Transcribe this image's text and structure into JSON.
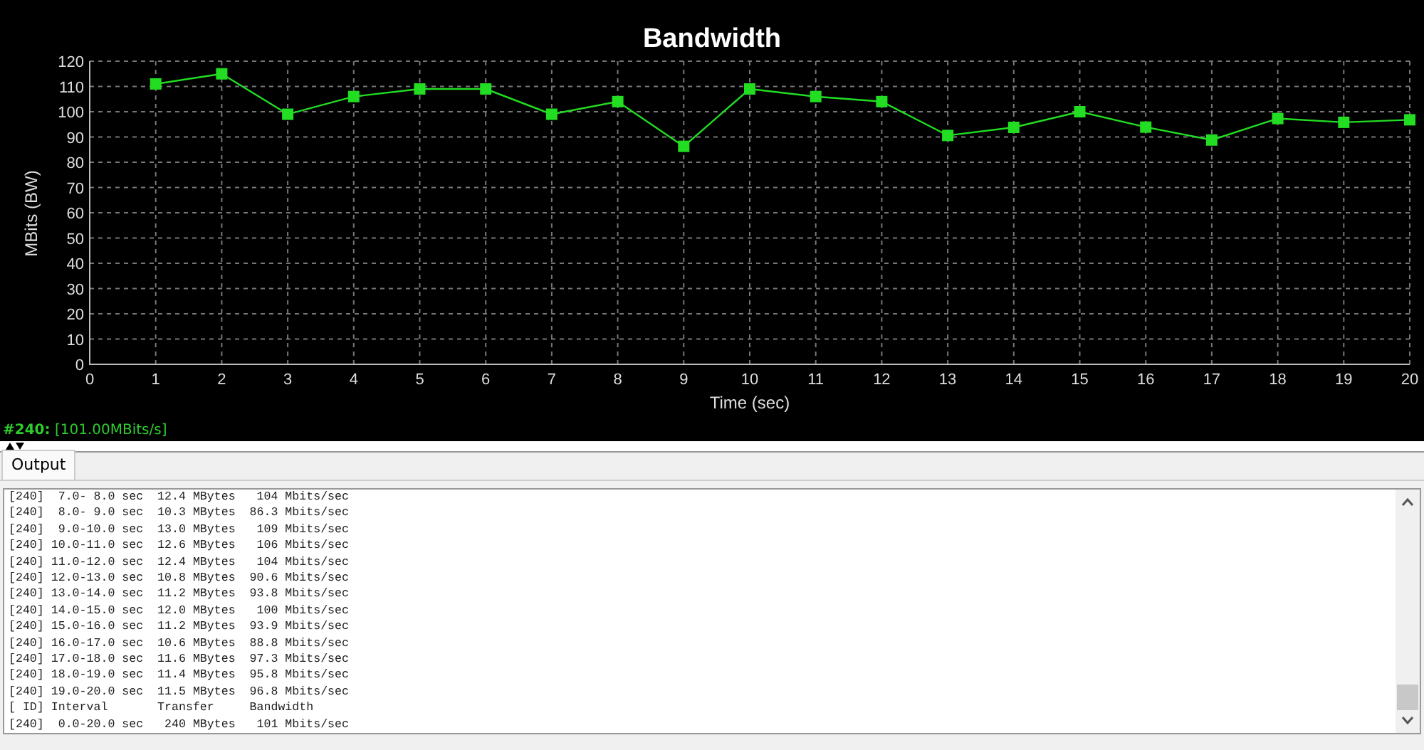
{
  "graph": {
    "chart_data": {
      "type": "line",
      "title": "Bandwidth",
      "xlabel": "Time (sec)",
      "ylabel": "MBits (BW)",
      "x": [
        1,
        2,
        3,
        4,
        5,
        6,
        7,
        8,
        9,
        10,
        11,
        12,
        13,
        14,
        15,
        16,
        17,
        18,
        19,
        20
      ],
      "grid": true,
      "series": [
        {
          "color": "#22dd22",
          "marker": "square",
          "values": [
            111,
            115,
            99,
            106,
            109,
            109,
            99,
            104,
            86.3,
            109,
            106,
            104,
            90.6,
            93.8,
            100,
            93.9,
            88.8,
            97.3,
            95.8,
            96.8
          ]
        }
      ],
      "xlim": [
        0,
        20
      ],
      "ylim": [
        0,
        120
      ],
      "xticks": [
        0,
        1,
        2,
        3,
        4,
        5,
        6,
        7,
        8,
        9,
        10,
        11,
        12,
        13,
        14,
        15,
        16,
        17,
        18,
        19,
        20
      ],
      "yticks": [
        0,
        10,
        20,
        30,
        40,
        50,
        60,
        70,
        80,
        90,
        100,
        110,
        120
      ]
    }
  },
  "status": {
    "stream": "#240:",
    "reading": "[101.00MBits/s]"
  },
  "tabs": [
    {
      "label": "Output",
      "selected": true
    }
  ],
  "output": {
    "lines": [
      "[240]  7.0- 8.0 sec  12.4 MBytes   104 Mbits/sec",
      "[240]  8.0- 9.0 sec  10.3 MBytes  86.3 Mbits/sec",
      "[240]  9.0-10.0 sec  13.0 MBytes   109 Mbits/sec",
      "[240] 10.0-11.0 sec  12.6 MBytes   106 Mbits/sec",
      "[240] 11.0-12.0 sec  12.4 MBytes   104 Mbits/sec",
      "[240] 12.0-13.0 sec  10.8 MBytes  90.6 Mbits/sec",
      "[240] 13.0-14.0 sec  11.2 MBytes  93.8 Mbits/sec",
      "[240] 14.0-15.0 sec  12.0 MBytes   100 Mbits/sec",
      "[240] 15.0-16.0 sec  11.2 MBytes  93.9 Mbits/sec",
      "[240] 16.0-17.0 sec  10.6 MBytes  88.8 Mbits/sec",
      "[240] 17.0-18.0 sec  11.6 MBytes  97.3 Mbits/sec",
      "[240] 18.0-19.0 sec  11.4 MBytes  95.8 Mbits/sec",
      "[240] 19.0-20.0 sec  11.5 MBytes  96.8 Mbits/sec",
      "[ ID] Interval       Transfer     Bandwidth",
      "[240]  0.0-20.0 sec   240 MBytes   101 Mbits/sec"
    ]
  }
}
